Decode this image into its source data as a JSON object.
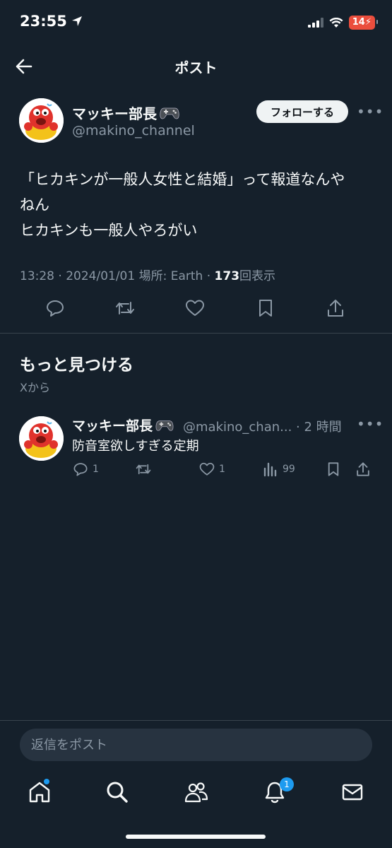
{
  "status_bar": {
    "time": "23:55",
    "battery": "14"
  },
  "nav": {
    "title": "ポスト"
  },
  "post": {
    "author_name": "マッキー部長",
    "handle": "@makino_channel",
    "follow_label": "フォローする",
    "body": "「ヒカキンが一般人女性と結婚」って報道なんや\nねん\nヒカキンも一般人やろがい",
    "meta_prefix": "13:28 · 2024/01/01 場所: Earth · ",
    "views": "173",
    "views_label": "回表示"
  },
  "discover": {
    "title": "もっと見つける",
    "subtitle": "Xから"
  },
  "reply_item": {
    "author_name": "マッキー部長",
    "handle_time": "@makino_chan... · 2 時間",
    "text": "防音室欲しすぎる定期",
    "replies": "1",
    "likes": "1",
    "views": "99"
  },
  "composer": {
    "placeholder": "返信をポスト"
  },
  "tabbar": {
    "notifications_badge": "1"
  },
  "colors": {
    "background": "#15202b",
    "accent": "#1d9bf0",
    "muted": "#8b98a5",
    "battery": "#eb4e3d"
  }
}
